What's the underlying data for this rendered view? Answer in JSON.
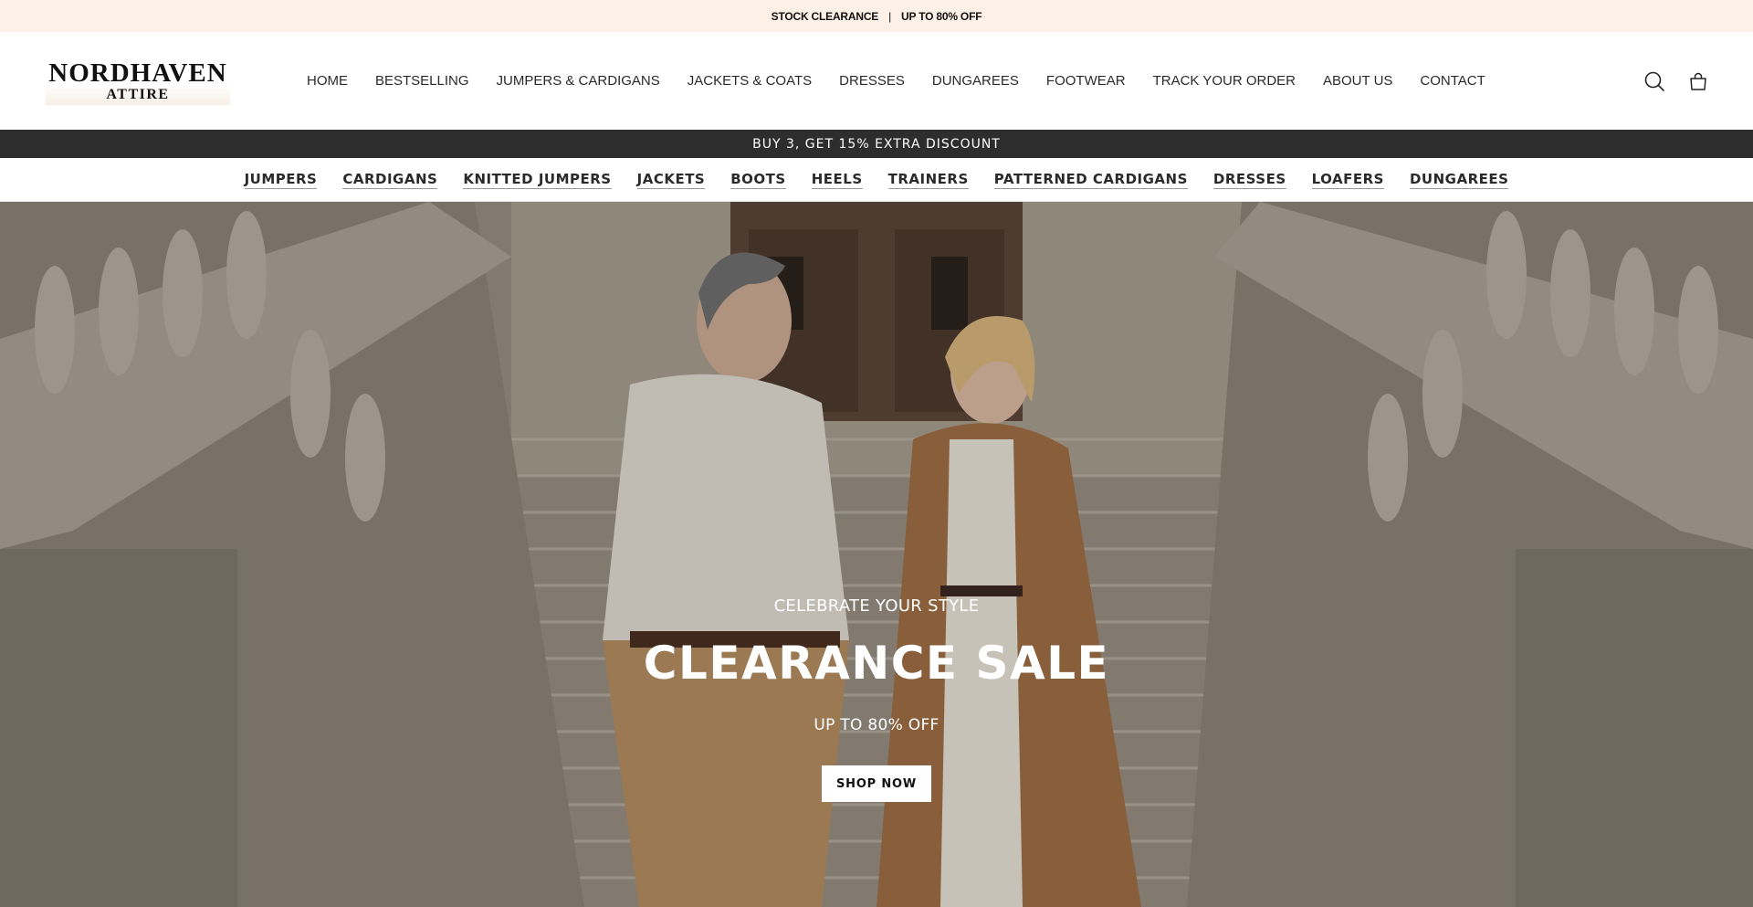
{
  "announcement": {
    "left": "STOCK CLEARANCE",
    "separator": "|",
    "right": "UP TO 80% OFF"
  },
  "brand": {
    "name": "NORDHAVEN",
    "tagline": "ATTIRE"
  },
  "main_nav": [
    {
      "label": "HOME"
    },
    {
      "label": "BESTSELLING"
    },
    {
      "label": "JUMPERS & CARDIGANS"
    },
    {
      "label": "JACKETS & COATS"
    },
    {
      "label": "DRESSES"
    },
    {
      "label": "DUNGAREES"
    },
    {
      "label": "FOOTWEAR"
    },
    {
      "label": "TRACK YOUR ORDER"
    },
    {
      "label": "ABOUT US"
    },
    {
      "label": "CONTACT"
    }
  ],
  "header_icons": {
    "search": "search-icon",
    "cart": "cart-icon"
  },
  "promo": {
    "text": "BUY 3, GET 15% EXTRA DISCOUNT"
  },
  "category_nav": [
    {
      "label": "JUMPERS"
    },
    {
      "label": "CARDIGANS"
    },
    {
      "label": "KNITTED JUMPERS"
    },
    {
      "label": "JACKETS"
    },
    {
      "label": "BOOTS"
    },
    {
      "label": "HEELS"
    },
    {
      "label": "TRAINERS"
    },
    {
      "label": "PATTERNED CARDIGANS"
    },
    {
      "label": "DRESSES"
    },
    {
      "label": "LOAFERS"
    },
    {
      "label": "DUNGAREES"
    }
  ],
  "hero": {
    "kicker": "CELEBRATE YOUR STYLE",
    "title": "CLEARANCE SALE",
    "subtitle": "UP TO 80% OFF",
    "button_label": "SHOP NOW"
  },
  "colors": {
    "announcement_bg": "#fdf0e6",
    "promo_bg": "#2d2d2d",
    "text": "#1c1c1c"
  }
}
